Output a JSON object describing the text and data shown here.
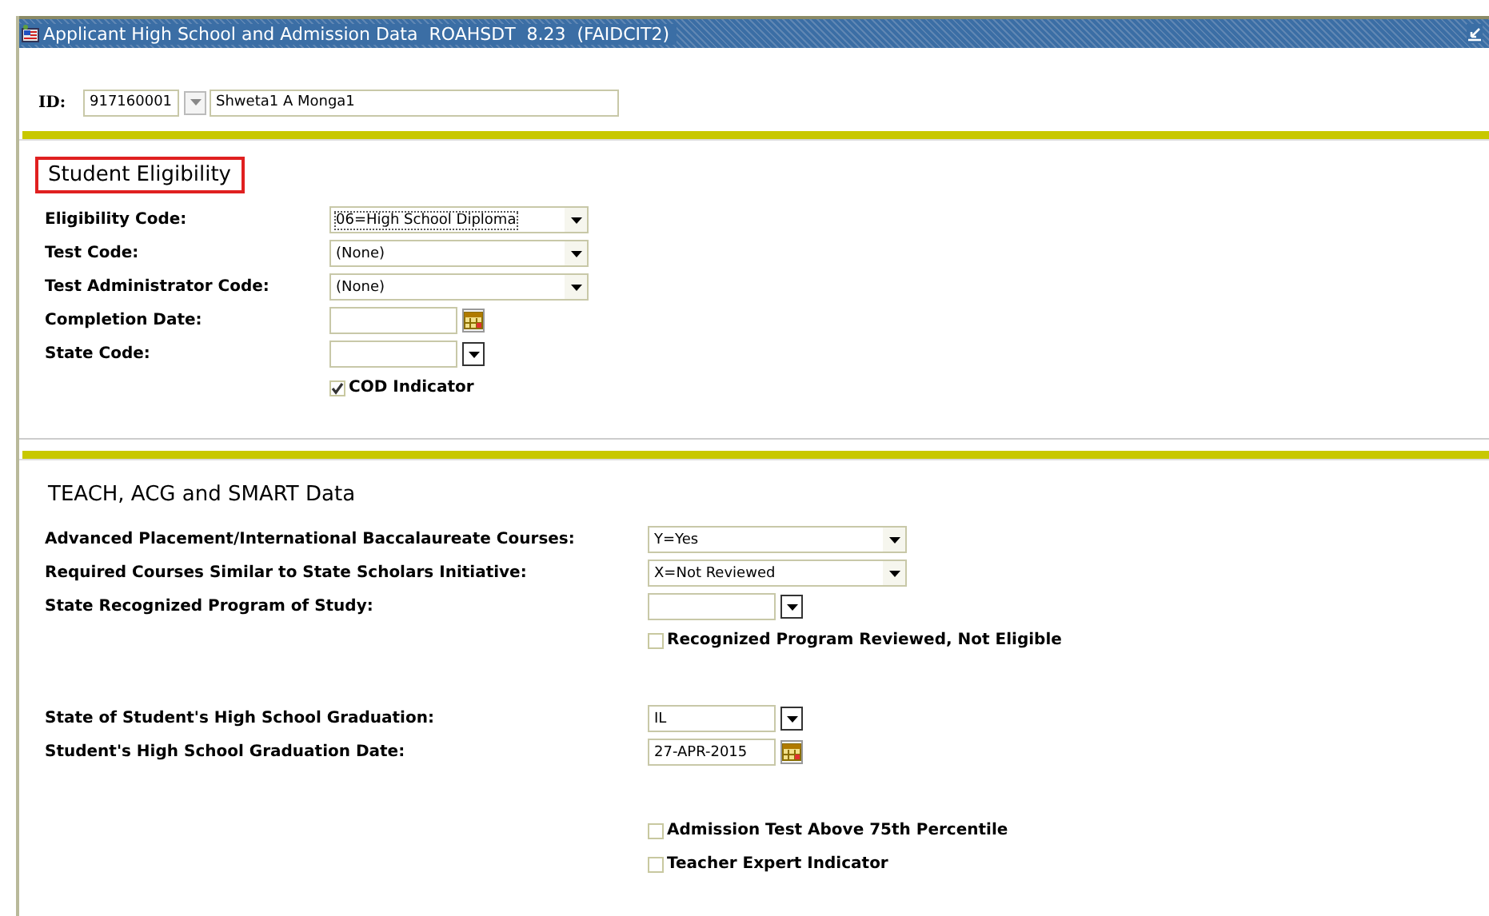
{
  "window": {
    "title": "Applicant High School and Admission Data  ROAHSDT  8.23  (FAIDCIT2)"
  },
  "id_row": {
    "label": "ID:",
    "id": "917160001",
    "name": "Shweta1 A Monga1"
  },
  "sections": [
    {
      "heading": "Student Eligibility",
      "highlighted": true,
      "groups": [
        [
          {
            "kind": "select",
            "label": "Eligibility Code:",
            "value": "06=High School Diploma",
            "focused": true
          },
          {
            "kind": "select",
            "label": "Test Code:",
            "value": "(None)",
            "focused": false
          },
          {
            "kind": "select",
            "label": "Test Administrator Code:",
            "value": "(None)",
            "focused": false
          },
          {
            "kind": "date",
            "label": "Completion Date:"
          },
          {
            "kind": "lookup",
            "label": "State Code:"
          },
          {
            "kind": "checkbox",
            "label": "COD Indicator",
            "checked": true
          }
        ]
      ]
    },
    {
      "heading": "TEACH, ACG and SMART Data",
      "highlighted": false,
      "groups": [
        [
          {
            "kind": "select",
            "label": "Advanced Placement/International Baccalaureate Courses:",
            "value": "Y=Yes",
            "focused": false
          },
          {
            "kind": "select",
            "label": "Required Courses Similar to State Scholars Initiative:",
            "value": "X=Not Reviewed",
            "focused": false
          },
          {
            "kind": "lookup",
            "label": "State Recognized Program of Study:"
          },
          {
            "kind": "checkbox",
            "label": "Recognized Program Reviewed, Not Eligible",
            "checked": false
          }
        ],
        [
          {
            "kind": "lookup",
            "label": "State of Student's High School Graduation:",
            "value": "IL"
          },
          {
            "kind": "date",
            "label": "Student's High School Graduation Date:",
            "value": "27-APR-2015"
          }
        ],
        [
          {
            "kind": "checkbox",
            "label": "Admission Test Above 75th Percentile",
            "checked": false
          },
          {
            "kind": "checkbox",
            "label": "Teacher Expert Indicator",
            "checked": false
          }
        ]
      ]
    }
  ]
}
